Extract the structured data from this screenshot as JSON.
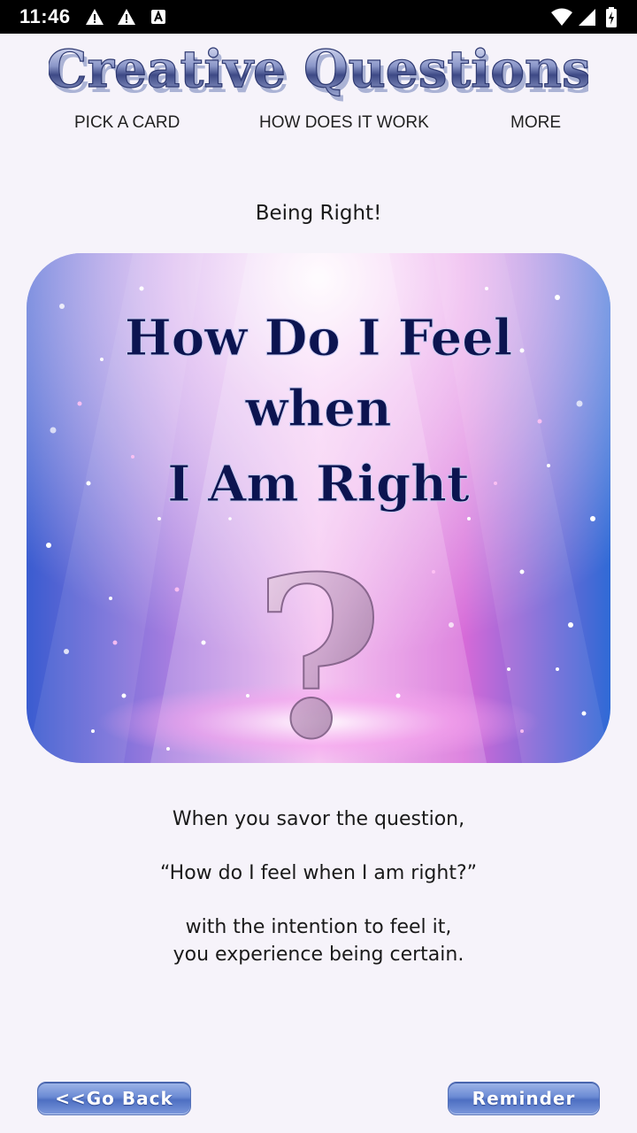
{
  "status_bar": {
    "time": "11:46",
    "notification_icons": [
      "warning-icon",
      "warning-icon",
      "text-a-icon"
    ],
    "system_icons": [
      "wifi-icon",
      "signal-icon",
      "battery-charging-icon"
    ]
  },
  "app": {
    "logo_text": "Creative Questions",
    "nav": {
      "pick_card": "PICK A CARD",
      "how_it_works": "HOW DOES IT WORK",
      "more": "MORE"
    }
  },
  "card": {
    "title": "Being Right!",
    "image_lines": [
      "How Do I Feel",
      "when",
      "I Am Right"
    ],
    "image_symbol": "?"
  },
  "body": {
    "line1": "When you savor the question,",
    "line2": "“How do I feel when I am right?”",
    "line3": "with the intention to feel it,",
    "line4": "you experience being certain."
  },
  "buttons": {
    "back": "<<Go Back",
    "reminder": "Reminder"
  },
  "colors": {
    "background": "#f6f3fa",
    "button_blue": "#5a7ccb",
    "card_text": "#0c1450"
  }
}
